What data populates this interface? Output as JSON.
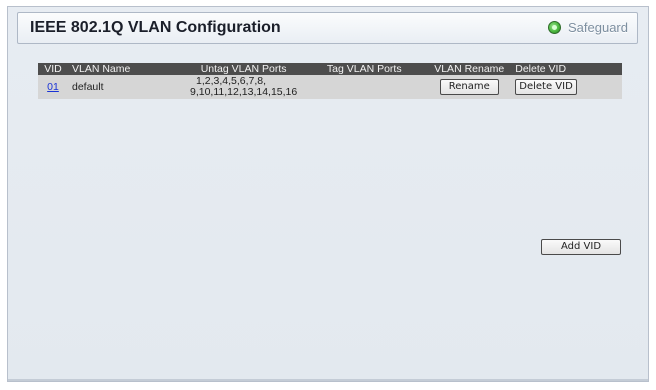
{
  "header": {
    "title": "IEEE 802.1Q VLAN Configuration",
    "safeguard_label": "Safeguard"
  },
  "table": {
    "columns": [
      "VID",
      "VLAN Name",
      "Untag VLAN Ports",
      "Tag VLAN Ports",
      "VLAN Rename",
      "Delete VID"
    ],
    "rows": [
      {
        "vid": "01",
        "name": "default",
        "untag_line1": "1,2,3,4,5,6,7,8,",
        "untag_line2": "9,10,11,12,13,14,15,16",
        "tag": "",
        "rename_label": "Rename",
        "delete_label": "Delete VID"
      }
    ]
  },
  "actions": {
    "add_vid_label": "Add VID"
  },
  "colors": {
    "header_row_bg": "#4d4d4d",
    "data_row_bg": "#d6d6d6",
    "link": "#1a33d6",
    "safeguard_led": "#4bb83f"
  },
  "icons": [
    "safeguard-led-icon"
  ]
}
